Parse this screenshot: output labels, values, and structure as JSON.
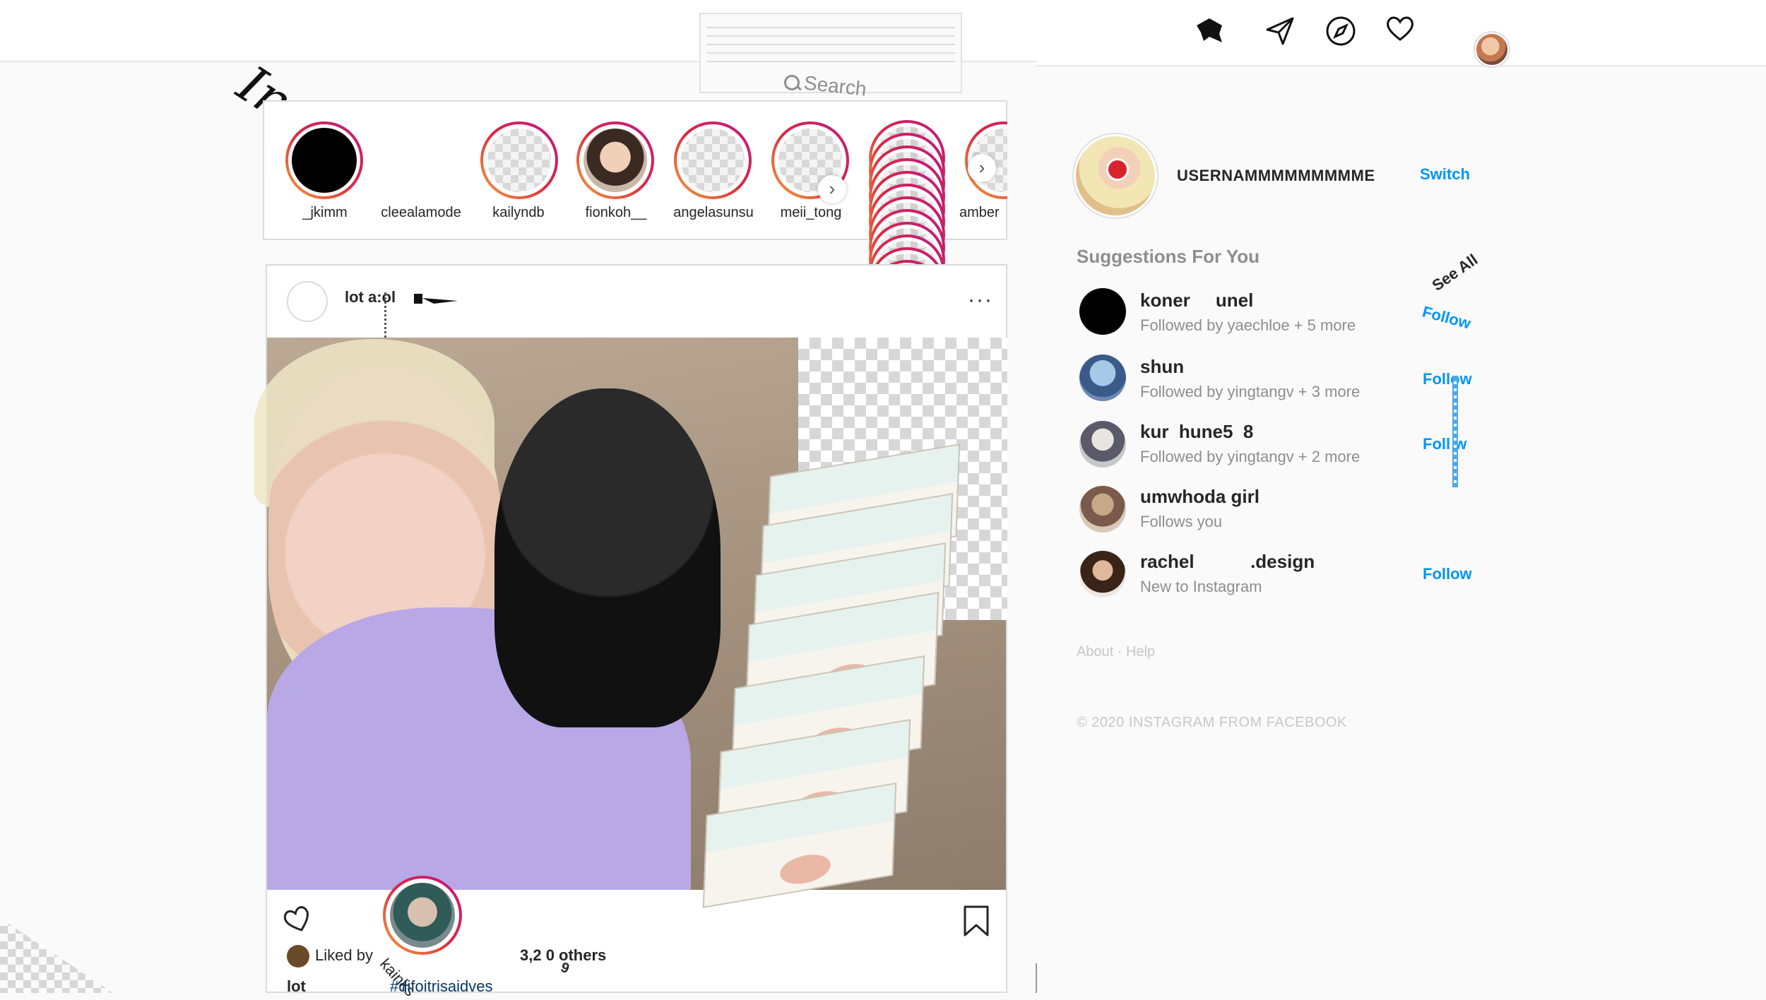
{
  "header": {
    "logo": "Instagram",
    "search_placeholder": "Search",
    "icons": [
      "home-icon",
      "direct-icon",
      "explore-icon",
      "activity-heart-icon",
      "profile-avatar"
    ]
  },
  "stories": [
    {
      "name": "_jkimm",
      "style": "black"
    },
    {
      "name": "cleealamode",
      "style": "none"
    },
    {
      "name": "kailyndb",
      "style": "checker"
    },
    {
      "name": "fionkoh__",
      "style": "photo"
    },
    {
      "name": "angelasunsu",
      "style": "checker"
    },
    {
      "name": "meii_tong",
      "style": "checker"
    },
    {
      "name": "amber",
      "style": "checker"
    }
  ],
  "post": {
    "username": "lot a:ol",
    "more": "···",
    "liked_by_prefix": "Liked by",
    "liked_by_name": "kainks",
    "likes": "3,2 0 others",
    "likes_sub": "9",
    "caption_user": "lot",
    "caption_tag": "#difoitrisaidves"
  },
  "sidebar": {
    "username": "USERNAMMMMMMMMME",
    "switch_label": "Switch",
    "suggestions_title": "Suggestions For You",
    "see_all": "See All",
    "suggestions": [
      {
        "name": "koner     unel",
        "sub": "Followed by yaechloe + 5 more",
        "action": "Follow"
      },
      {
        "name": "shun",
        "sub": "Followed by yingtangv + 3 more",
        "action": "Follow"
      },
      {
        "name": "kur  hune5  8",
        "sub": "Followed by yingtangv + 2 more",
        "action": "Foll w"
      },
      {
        "name": "umwhoda girl",
        "sub": "Follows you",
        "action": ""
      },
      {
        "name": "rachel           .design",
        "sub": "New to Instagram",
        "action": "Follow"
      }
    ],
    "footer_links": "About · Help",
    "copyright": "© 2020 INSTAGRAM FROM FACEBOOK"
  },
  "colors": {
    "accent": "#0095f6",
    "text": "#262626",
    "muted": "#8e8e8e",
    "border": "#dbdbdb"
  }
}
